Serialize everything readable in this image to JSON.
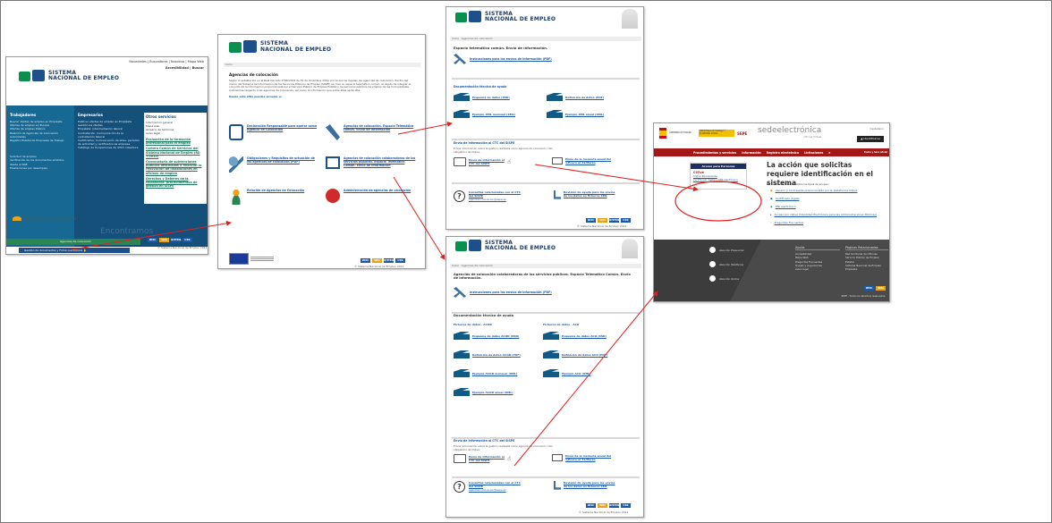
{
  "panel1": {
    "header_links": "Novedades | Buscadores | Nosotros | Mapa Web",
    "header_access": "Accesibilidad | Buscar",
    "logo_line1": "SISTEMA",
    "logo_line2": "NACIONAL DE EMPLEO",
    "col1_title": "Trabajadores",
    "col1_items": [
      "Buscar ofertas de empleo en Empléate",
      "Ofertas de empleo en Europa",
      "Ofertas de empleo Público",
      "Relación de Agencias de Colocación Autorizadas",
      "Registro Estatal de Empresas de Trabajo"
    ],
    "col1_items_b": [
      "Solicitud de empleo",
      "Verificación de los documentos emitidos desde el SNE",
      "Prestaciones por desempleo"
    ],
    "col2_title": "Empresarios",
    "col2_items": [
      "Publicar ofertas de empleo en Empléate",
      "Gestión de ofertas",
      "Empléate: Intermediación laboral",
      "Contratación: Comunicación de la contratación laboral",
      "Certificados: Comunicación de altas, períodos de actividad y certificados de empresa",
      "Catálogo de Ocupaciones de difícil cobertura"
    ],
    "col3_title": "Otros servicios",
    "col3_items": [
      "Información general",
      "Mapa web",
      "Glosario de términos",
      "Aviso legal"
    ],
    "col3_links": [
      "Evaluación de la formación profesional para el empleo",
      "Cartera Común de Servicios del Sistema Nacional de Empleo (RD 7/2015)",
      "Convocatoria de subvenciones públicas destinadas a financiar la renovación de instalaciones en oficinas de empleo",
      "Derechos y Deberes de la ciudadanía: procedimientos de gestión en SISPE"
    ],
    "agencias_label": "Agencias de colocación",
    "pin_text": "Gestión de documentos y Firma Electrónica",
    "tagline": "Encontramos",
    "footer_logo": "Servicios Públicos de Empleo",
    "footer_copy": "© Sistema Nacional de Empleo 2011"
  },
  "panel2": {
    "logo_line1": "SISTEMA",
    "logo_line2": "NACIONAL DE EMPLEO",
    "breadcrumb": "Inicio",
    "title": "Agencias de colocación",
    "intro": "Según lo establecido en el Real Decreto 1796/2010 de 30 de diciembre 2010, por el que se regulan las agencias de colocación, dentro del marco del Sistema de Información de los Servicios Públicos de Empleo (SISPE) se crea un espacio telemático común, al objeto de integrar el conjunto de la información proporcionada por el Servicio Público de Empleo Estatal y los servicios públicos de empleo de las Comunidades Autónomas respecto a las agencias de colocación, así como la información que sobre ellas se facilite.",
    "question": "Desde este sitio puedes acceder a:",
    "items": [
      "Declaración Responsable para operar como Agencia de Colocación",
      "Agencias de colocación. Espacio Telemático común. Envío de información",
      "Obligaciones y Requisitos de actuación de las agencias de colocación (PDF)",
      "Agencias de colocación colaboradoras de los servicios públicos. Espacio Telemático Común. Envío de información",
      "Relación de Agencias de Colocación",
      "Administración de agencias de colocación"
    ],
    "footer_copy": "© Sistema Nacional de Empleo 2011"
  },
  "panel3": {
    "logo_line1": "SISTEMA",
    "logo_line2": "NACIONAL DE EMPLEO",
    "breadcrumb": "Inicio · Agencias de colocación",
    "title": "Espacio telemático común. Envío de información.",
    "instrucciones": "Instrucciones para los envíos de información (PDF)",
    "doc_title": "Documentación técnica de ayuda",
    "docs": [
      "Esquema de datos (XSD)",
      "Definición de datos (PDF)",
      "Ejemplo XML mensual (XML)",
      "Ejemplo XML anual (XML)"
    ],
    "envio_title": "Envío de información al CTC del SISPE",
    "envio_text": "Enviar información sobre la gestión realizada como agencia de colocación. Uso obligatorio de Cl@ve.",
    "envio_link": "Envío de información al CTC del SISPE",
    "memoria_link": "Envío de la memoria anual del 1/Enero al 31/Marzo",
    "consultas_link": "Consultas relacionadas con el CTC del SISPE",
    "consultas_mail": "agencias.colocacion@sepe.es",
    "revision_link": "Revisión de ayuda para los envíos de los datos en ficheros XML",
    "footer_copy": "© Sistema Nacional de Empleo 2011"
  },
  "panel4": {
    "logo_line1": "SISTEMA",
    "logo_line2": "NACIONAL DE EMPLEO",
    "breadcrumb": "Inicio · Agencias de colocación",
    "title": "Agencias de colocación colaboradoras de los servicios públicos. Espacio Telemático Común. Envío de información.",
    "instrucciones": "Instrucciones para los envíos de información (PDF)",
    "doc_title": "Documentación técnica de ayuda",
    "col_a_title": "Ficheros de datos · ACOD",
    "col_b_title": "Ficheros de datos · ACO",
    "col_a": [
      "Esquema de datos ACOD (XSD)",
      "Definición de datos ACOD (PDF)",
      "Ejemplo ACOD mensual (XML)",
      "Ejemplo ACOD anual (XML)"
    ],
    "col_b": [
      "Esquema de datos ACO (XSD)",
      "Definición de datos ACO (PDF)",
      "Ejemplo ACO (XML)"
    ],
    "envio_title": "Envío de información al CTC del SISPE",
    "envio_text": "Enviar información sobre la gestión realizada como agencia de colocación. Uso obligatorio de Cl@ve.",
    "envio_link": "Envío de información al CTC del SISPE",
    "memoria_link": "Envío de la memoria anual del 1/Enero al 31/Marzo",
    "consultas_link": "Consultas relacionadas con el CTC del SISPE",
    "consultas_mail": "agencias.colocacion@sepe.es",
    "revision_link": "Revisión de ayuda para los envíos de los datos en ficheros XML",
    "footer_copy": "© Sistema Nacional de Empleo 2011"
  },
  "panel5": {
    "gov1": "GOBIERNO DE ESPAÑA",
    "gov2": "MINISTERIO DE TRABAJO Y ECONOMÍA SOCIAL",
    "sepe": "SEPE",
    "sede_brand": "sedeelectrónica",
    "sede_sub": "Oficina Virtual",
    "lang": "Castellano",
    "identify_btn": "Identificarse",
    "nav": [
      "Procedimientos y servicios",
      "Información",
      "Registro electrónico",
      "Licitaciones"
    ],
    "nav_right": "Fecha y hora oficial",
    "access_box_title": "Acceso para Personas",
    "clave_label": "Cl@ve",
    "access_links": [
      "Cl@ve Permanente",
      "Certificado digital o DNI electrónico"
    ],
    "heading": "La acción que solicitas requiere identificación en el sistema",
    "info_text": "Para más información sobre los tipos de acceso:",
    "info_items": [
      "Usuario y contraseña proporcionado por la plataforma Cl@ve",
      "Certificado digital",
      "DNI electrónico",
      "Acceso por cl@ve (Identidad Electrónica para las Administraciones Públicas)",
      "Preguntas Frecuentes"
    ],
    "footer_contact": [
      "Atención Presencial",
      "Atención Telefónica",
      "Atención Online"
    ],
    "ayuda_title": "Ayuda",
    "ayuda_items": [
      "Accesibilidad",
      "Mapa Web",
      "Preguntas Frecuentes",
      "Quejas y sugerencias",
      "Aviso legal"
    ],
    "rel_title": "Páginas Relacionadas",
    "rel_items": [
      "Red territorial de Oficinas",
      "Servicio Público de Empleo Estatal",
      "Sistema Nacional de Empleo",
      "Empléate"
    ],
    "copyright": "SEPE - Todos los derechos reservados."
  },
  "badges": [
    "W3C",
    "WAI",
    "XHTML",
    "CSS"
  ],
  "colors": {
    "sne_green": "#0b8f4d",
    "sne_blue": "#1c4f8c",
    "panel1_header": "#14507a",
    "sede_nav": "#a31717",
    "sede_footer": "#4a4a4a",
    "arrow_red": "#e02020"
  }
}
